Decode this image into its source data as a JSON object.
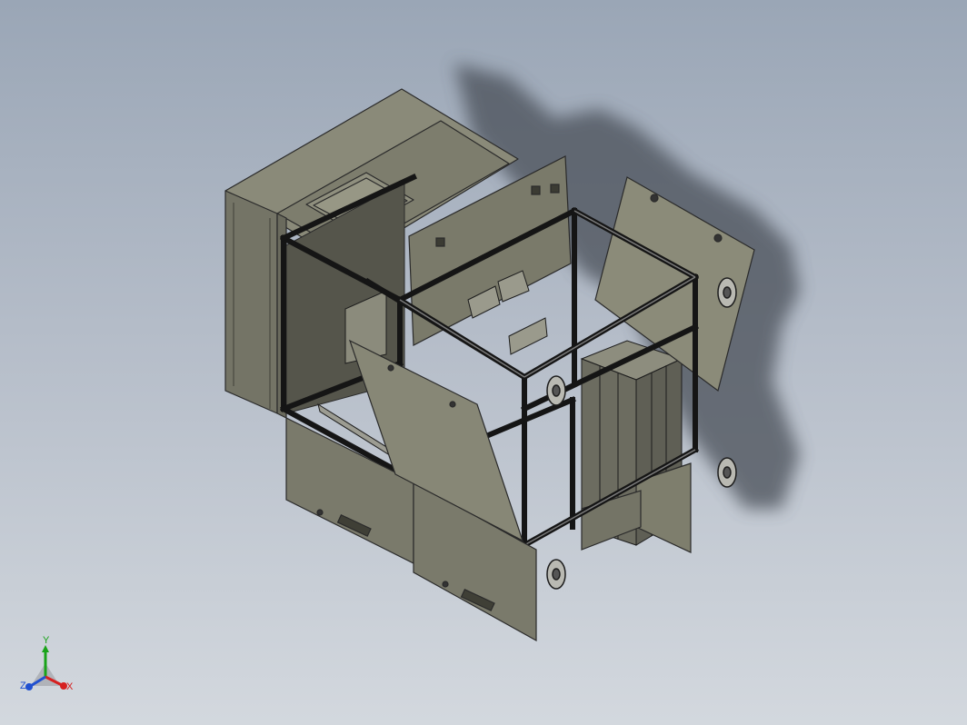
{
  "colors": {
    "background_top": "#9aa6b6",
    "background_bottom": "#d3d8de",
    "panel_fill": "#7b7b6c",
    "panel_dark": "#5f5f54",
    "frame": "#2a2a2a",
    "caster": "#b9b9b2",
    "axis_x": "#d62020",
    "axis_y": "#19a319",
    "axis_z": "#2050d0"
  },
  "triad": {
    "x_label": "X",
    "y_label": "Y",
    "z_label": "Z"
  },
  "model": {
    "icons": [
      "cabinet-body",
      "side-door-open",
      "front-door-open",
      "lower-front-panels",
      "extrusion-frame",
      "caster-wheels",
      "battery-pack"
    ]
  }
}
